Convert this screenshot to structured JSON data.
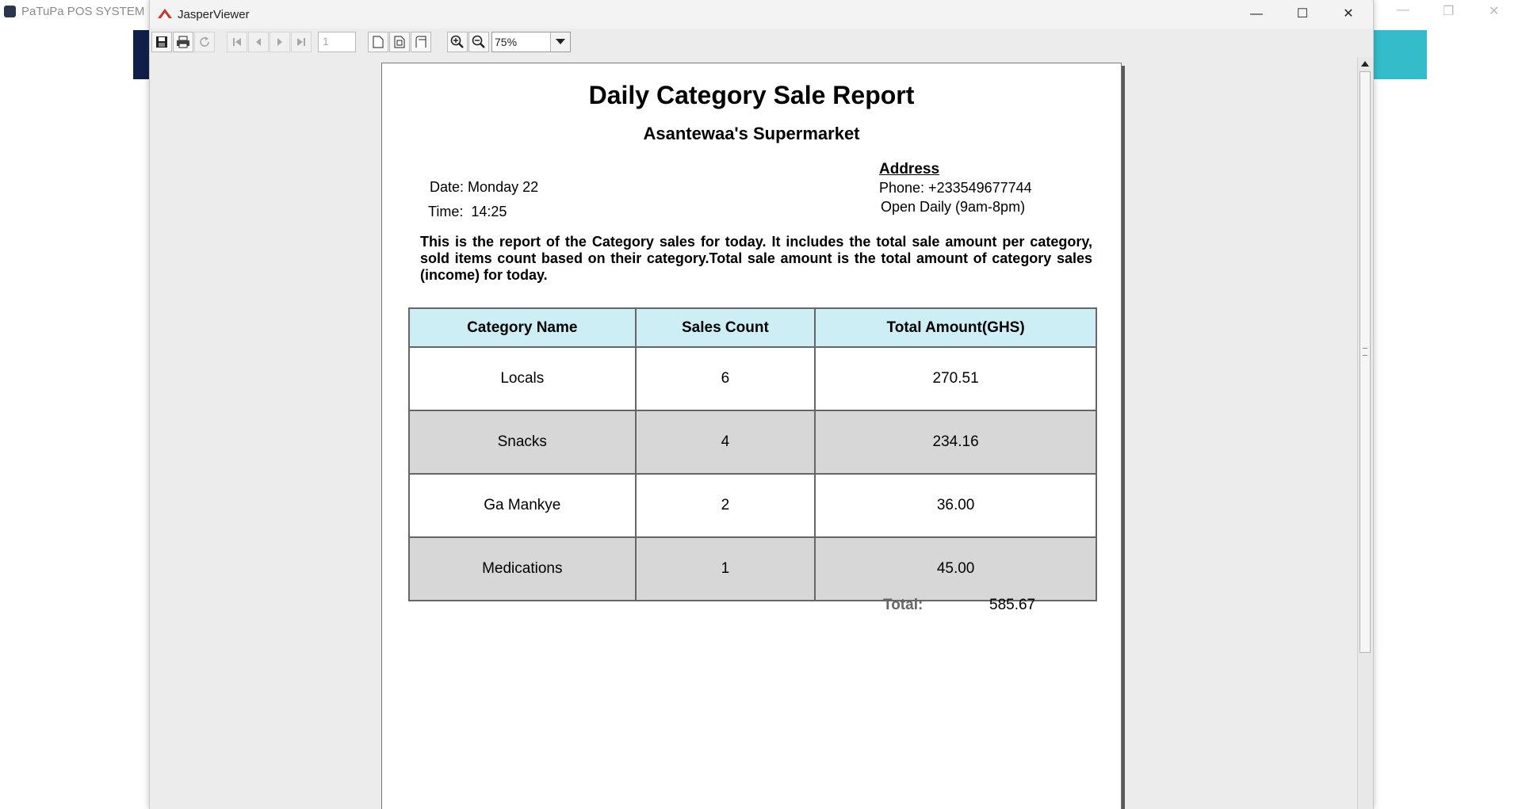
{
  "background_app": {
    "title": "PaTuPa POS SYSTEM"
  },
  "window": {
    "title": "JasperViewer",
    "controls": {
      "minimize": "—",
      "maximize": "☐",
      "close": "✕"
    }
  },
  "toolbar": {
    "page_number": "1",
    "zoom": "75%"
  },
  "report": {
    "title": "Daily Category Sale Report",
    "subtitle": "Asantewaa's Supermarket",
    "date_label": "Date:",
    "date_value": "Monday 22",
    "time_label": "Time:",
    "time_value": "14:25",
    "address_heading": "Address",
    "phone": "Phone: +233549677744",
    "hours": "Open Daily (9am-8pm)",
    "description": "This is the report of the Category sales for today. It includes the total sale amount per category, sold items count based on their category.Total sale amount is the total amount of category sales (income) for today.",
    "columns": [
      "Category Name",
      "Sales Count",
      "Total Amount(GHS)"
    ],
    "rows": [
      [
        "Locals",
        "6",
        "270.51"
      ],
      [
        "Snacks",
        "4",
        "234.16"
      ],
      [
        "Ga Mankye",
        "2",
        "36.00"
      ],
      [
        "Medications",
        "1",
        "45.00"
      ]
    ],
    "total_label": "Total:",
    "total_value": "585.67"
  }
}
